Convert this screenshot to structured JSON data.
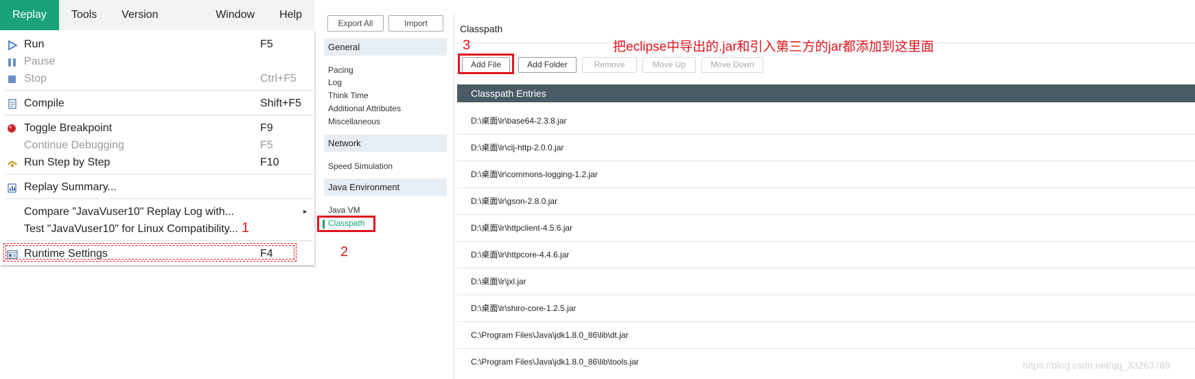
{
  "menubar": {
    "items": [
      "Replay",
      "Tools",
      "Version Control",
      "Window",
      "Help"
    ],
    "active_index": 0
  },
  "replay_menu": {
    "run": {
      "label": "Run",
      "shortcut": "F5"
    },
    "pause": {
      "label": "Pause"
    },
    "stop": {
      "label": "Stop",
      "shortcut": "Ctrl+F5"
    },
    "compile": {
      "label": "Compile",
      "shortcut": "Shift+F5"
    },
    "toggle_breakpoint": {
      "label": "Toggle Breakpoint",
      "shortcut": "F9"
    },
    "continue_debugging": {
      "label": "Continue Debugging",
      "shortcut": "F5"
    },
    "run_step": {
      "label": "Run Step by Step",
      "shortcut": "F10"
    },
    "replay_summary": {
      "label": "Replay Summary..."
    },
    "compare": {
      "label": "Compare \"JavaVuser10\" Replay Log with...",
      "arrow": "▸"
    },
    "test_linux": {
      "label": "Test \"JavaVuser10\" for Linux Compatibility..."
    },
    "runtime_settings": {
      "label": "Runtime Settings",
      "shortcut": "F4"
    }
  },
  "settings_nav": {
    "export_all": "Export All",
    "import": "Import",
    "groups": {
      "general": {
        "title": "General",
        "items": [
          "Pacing",
          "Log",
          "Think Time",
          "Additional Attributes",
          "Miscellaneous"
        ]
      },
      "network": {
        "title": "Network",
        "items": [
          "Speed Simulation"
        ]
      },
      "java_environment": {
        "title": "Java Environment",
        "items": [
          "Java VM",
          "Classpath"
        ]
      }
    },
    "selected": "Classpath",
    "accent_color": "#1aa37a"
  },
  "classpath": {
    "title": "Classpath",
    "toolbar": {
      "add_file": "Add File",
      "add_folder": "Add Folder",
      "remove": "Remove",
      "move_up": "Move Up",
      "move_down": "Move Down"
    },
    "entries_header": "Classpath Entries",
    "entries": [
      "D:\\桌面\\lr\\base64-2.3.8.jar",
      "D:\\桌面\\lr\\clj-http-2.0.0.jar",
      "D:\\桌面\\lr\\commons-logging-1.2.jar",
      "D:\\桌面\\lr\\gson-2.8.0.jar",
      "D:\\桌面\\lr\\httpclient-4.5.6.jar",
      "D:\\桌面\\lr\\httpcore-4.4.6.jar",
      "D:\\桌面\\lr\\jxl.jar",
      "D:\\桌面\\lr\\shiro-core-1.2.5.jar",
      "C:\\Program Files\\Java\\jdk1.8.0_86\\lib\\dt.jar",
      "C:\\Program Files\\Java\\jdk1.8.0_86\\lib\\tools.jar"
    ]
  },
  "annotations": {
    "step1": "1",
    "step2": "2",
    "step3": "3",
    "note": "把eclipse中导出的.jar和引入第三方的jar都添加到这里面",
    "color": "#e0141e"
  },
  "watermark": "https://blog.csdn.net/qq_33263769"
}
